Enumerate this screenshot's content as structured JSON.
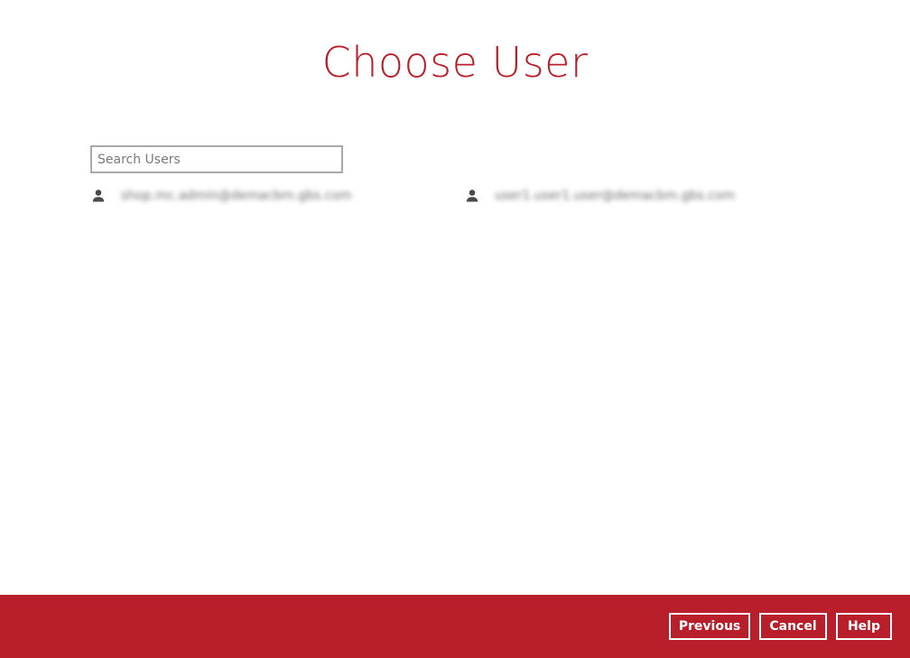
{
  "page": {
    "title": "Choose User"
  },
  "search": {
    "placeholder": "Search Users",
    "value": ""
  },
  "users": [
    {
      "email": "shop.mc.admin@demacbm.gbs.com",
      "icon": "person-icon"
    },
    {
      "email": "user1.user1.user@demacbm.gbs.com",
      "icon": "person-icon"
    }
  ],
  "footer": {
    "previous_label": "Previous",
    "cancel_label": "Cancel",
    "help_label": "Help"
  },
  "colors": {
    "accent": "#b91f2b",
    "icon": "#4a4a4a",
    "input_border": "#a9a9a9"
  }
}
